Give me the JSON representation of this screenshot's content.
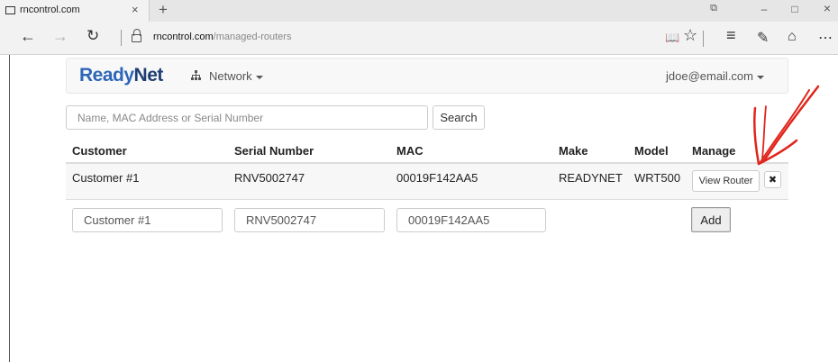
{
  "browser": {
    "tab_title": "rncontrol.com",
    "tab_close": "×",
    "new_tab": "+",
    "url_domain": "rncontrol.com",
    "url_path": "/managed-routers",
    "back": "←",
    "forward": "→",
    "refresh": "↻",
    "window": {
      "media": "⧉",
      "minimize": "–",
      "maximize": "□",
      "close": "×"
    },
    "tools": {
      "reading_view": "📖",
      "favorite": "☆",
      "hub": "≡",
      "web_note": "✎",
      "share": "⌂",
      "more": "⋯"
    }
  },
  "navbar": {
    "brand_ready": "Ready",
    "brand_net": "Net",
    "network_label": "Network",
    "user_email": "jdoe@email.com"
  },
  "search": {
    "placeholder": "Name, MAC Address or Serial Number",
    "button": "Search"
  },
  "table": {
    "headers": {
      "customer": "Customer",
      "serial": "Serial Number",
      "mac": "MAC",
      "make": "Make",
      "model": "Model",
      "manage": "Manage"
    },
    "rows": [
      {
        "customer": "Customer #1",
        "serial": "RNV5002747",
        "mac": "00019F142AA5",
        "make": "READYNET",
        "model": "WRT500",
        "view_button": "View Router",
        "remove_button": "✖"
      }
    ]
  },
  "add_form": {
    "customer_value": "Customer #1",
    "serial_value": "RNV5002747",
    "mac_value": "00019F142AA5",
    "add_button": "Add"
  },
  "colors": {
    "brand_blue": "#2d66b8",
    "brand_dark": "#1e3e73",
    "annotation_red": "#e0251b"
  }
}
